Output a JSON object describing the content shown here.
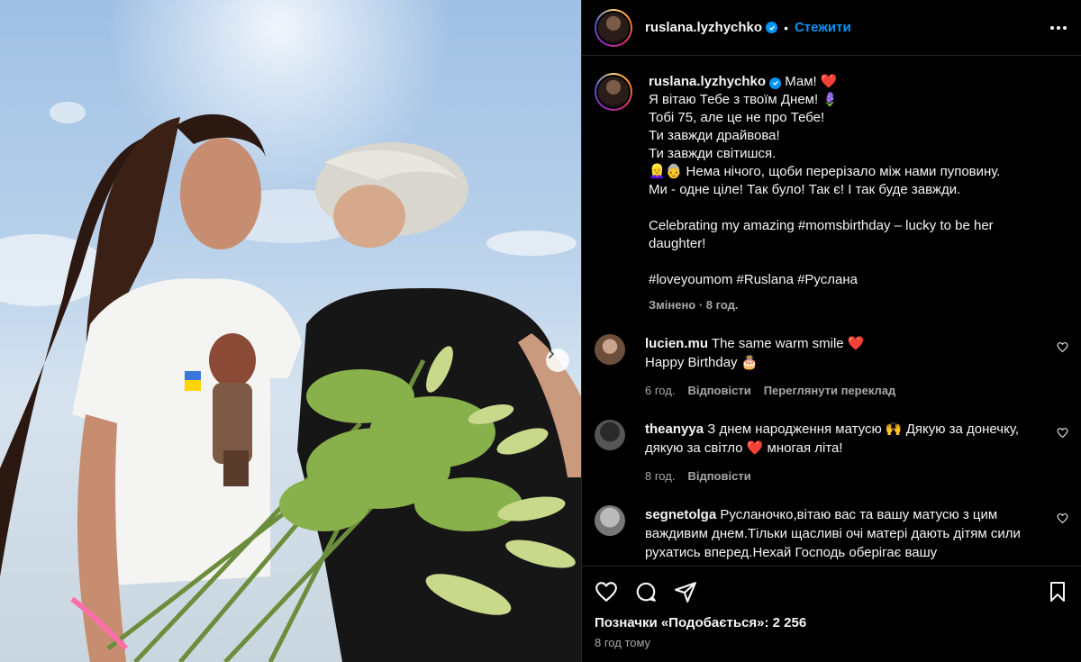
{
  "post": {
    "username": "ruslana.lyzhychko",
    "follow_label": "Стежити",
    "caption_lines": [
      "Мам! ❤️",
      "Я вітаю Тебе з твоїм Днем! 🪻",
      "Тобі 75, але це не про Тебе!",
      "Ти завжди драйвова!",
      "Ти завжди світишся.",
      "👱‍♀️👵 Нема нічого, щоби перерізало між нами пуповину.",
      "Ми - одне ціле! Так було! Так є! І так буде завжди.",
      "",
      "Celebrating my amazing #momsbirthday – lucky to be her daughter!",
      "",
      "#loveyoumom #Ruslana #Руслана"
    ],
    "caption_meta": "Змінено · 8 год.",
    "likes_label": "Позначки «Подобається»: 2 256",
    "time_ago": "8 год тому"
  },
  "comments": [
    {
      "username": "lucien.mu",
      "text": "The same warm smile ❤️",
      "text2": "Happy Birthday 🎂",
      "time": "6 год.",
      "reply": "Відповісти",
      "translate": "Переглянути переклад"
    },
    {
      "username": "theanyya",
      "text": "З днем народження матусю 🙌 Дякую за донечку, дякую за світло ❤️  многая літа!",
      "time": "8 год.",
      "reply": "Відповісти"
    },
    {
      "username": "segnetolga",
      "text": "Русланочко,вітаю вас та вашу матусю з цим важдивим днем.Тільки щасливі очі матері дають дітям сили рухатись вперед.Нехай Господь оберігає вашу"
    }
  ],
  "icons": {
    "like": "heart-icon",
    "comment": "comment-icon",
    "share": "share-icon",
    "save": "bookmark-icon",
    "more": "more-icon",
    "verified": "verified-icon",
    "next": "chevron-right-icon"
  },
  "colors": {
    "accent": "#0095f6",
    "background": "#000000",
    "text_secondary": "#a8a8a8",
    "heart": "#ed4956"
  }
}
